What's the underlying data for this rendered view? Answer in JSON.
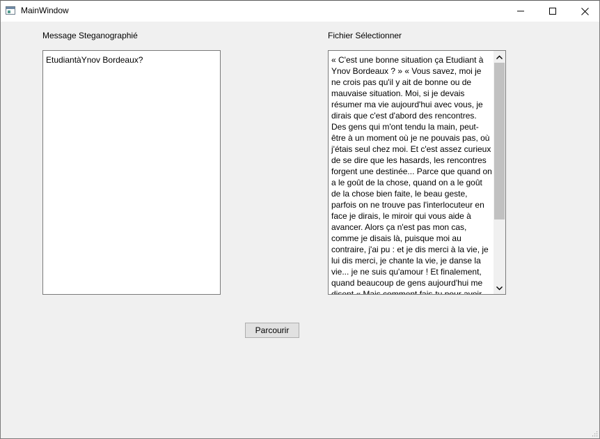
{
  "window": {
    "title": "MainWindow"
  },
  "labels": {
    "message": "Message Steganographié",
    "file": "Fichier Sélectionner"
  },
  "message_box": {
    "value": "EtudiantàYnov Bordeaux?"
  },
  "file_box": {
    "value": "« C'est une bonne situation ça Etudiant à Ynov Bordeaux ? » « Vous savez, moi je ne crois pas qu'il y ait de bonne ou de mauvaise situation. Moi, si je devais résumer ma vie aujourd'hui avec vous, je dirais que c'est d'abord des rencontres. Des gens qui m'ont tendu la main, peut-être à un moment où je ne pouvais pas, où j'étais seul chez moi. Et c'est assez curieux de se dire que les hasards, les rencontres forgent une destinée... Parce que quand on a le goût de la chose, quand on a le goût de la chose bien faite, le beau geste, parfois on ne trouve pas l'interlocuteur en face je dirais, le miroir qui vous aide à avancer. Alors ça n'est pas mon cas, comme je disais là, puisque moi au contraire, j'ai pu : et je dis merci à la vie, je lui dis merci, je chante la vie, je danse la vie... je ne suis qu'amour ! Et finalement, quand beaucoup de gens aujourd'hui me disent « Mais comment fais-tu pour avoir cette humanité",
    "scroll_position": 0.0
  },
  "buttons": {
    "browse": "Parcourir"
  },
  "icons": {
    "app": "window-app-icon",
    "minimize": "minimize-icon",
    "maximize": "maximize-icon",
    "close": "close-icon",
    "scroll_up": "chevron-up-icon",
    "scroll_down": "chevron-down-icon",
    "size_grip": "resize-grip-icon"
  }
}
